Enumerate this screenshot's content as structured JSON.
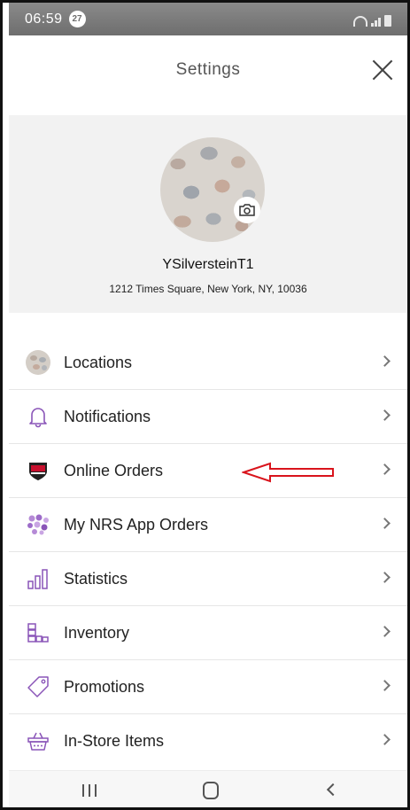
{
  "status_bar": {
    "time": "06:59",
    "badge": "27"
  },
  "header": {
    "title": "Settings"
  },
  "profile": {
    "username": "YSilversteinT1",
    "address": "1212 Times Square,  New York,  NY, 10036"
  },
  "menu": {
    "items": [
      {
        "label": "Locations",
        "icon": "location-avatar-icon"
      },
      {
        "label": "Notifications",
        "icon": "bell-icon"
      },
      {
        "label": "Online Orders",
        "icon": "br-badge-icon"
      },
      {
        "label": "My NRS App Orders",
        "icon": "dots-cluster-icon"
      },
      {
        "label": "Statistics",
        "icon": "bar-chart-icon"
      },
      {
        "label": "Inventory",
        "icon": "inventory-boxes-icon"
      },
      {
        "label": "Promotions",
        "icon": "tag-icon"
      },
      {
        "label": "In-Store Items",
        "icon": "basket-icon"
      }
    ]
  },
  "colors": {
    "accent_purple": "#8a55b8",
    "annotation_red": "#d9141c",
    "status_bar": "#7a7a7a"
  }
}
